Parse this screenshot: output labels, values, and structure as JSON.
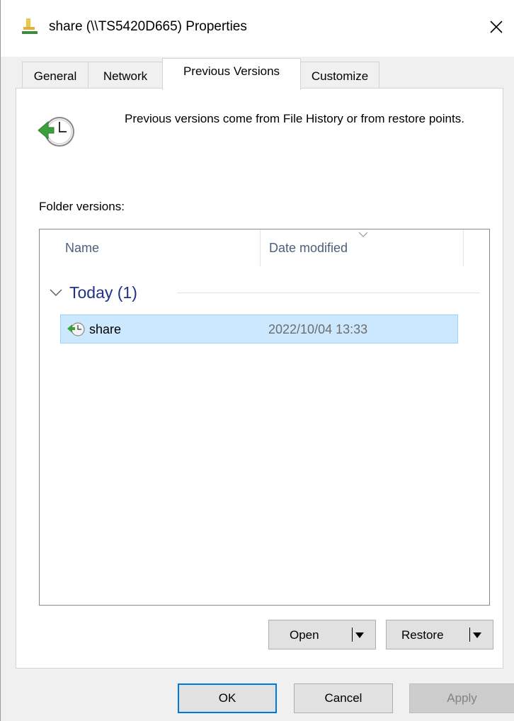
{
  "window": {
    "title": "share (\\\\TS5420D665) Properties",
    "close_glyph": "✕"
  },
  "tabs": [
    {
      "label": "General",
      "active": false
    },
    {
      "label": "Network",
      "active": false
    },
    {
      "label": "Previous Versions",
      "active": true
    },
    {
      "label": "Customize",
      "active": false
    }
  ],
  "info": {
    "icon": "restore-clock-icon",
    "text": "Previous versions come from File History or from restore points."
  },
  "folder_versions": {
    "label": "Folder versions:",
    "columns": [
      "Name",
      "Date modified"
    ],
    "sort_column": "Date modified",
    "groups": [
      {
        "label": "Today (1)",
        "expanded": true,
        "items": [
          {
            "name": "share",
            "date_modified": "2022/10/04 13:33",
            "selected": true
          }
        ]
      }
    ]
  },
  "actions": {
    "open_label": "Open",
    "restore_label": "Restore"
  },
  "dialog_buttons": {
    "ok_label": "OK",
    "cancel_label": "Cancel",
    "apply_label": "Apply",
    "apply_enabled": false
  },
  "colors": {
    "selection": "#cce8ff",
    "group_header": "#1e3287",
    "default_button_border": "#0078d7"
  }
}
